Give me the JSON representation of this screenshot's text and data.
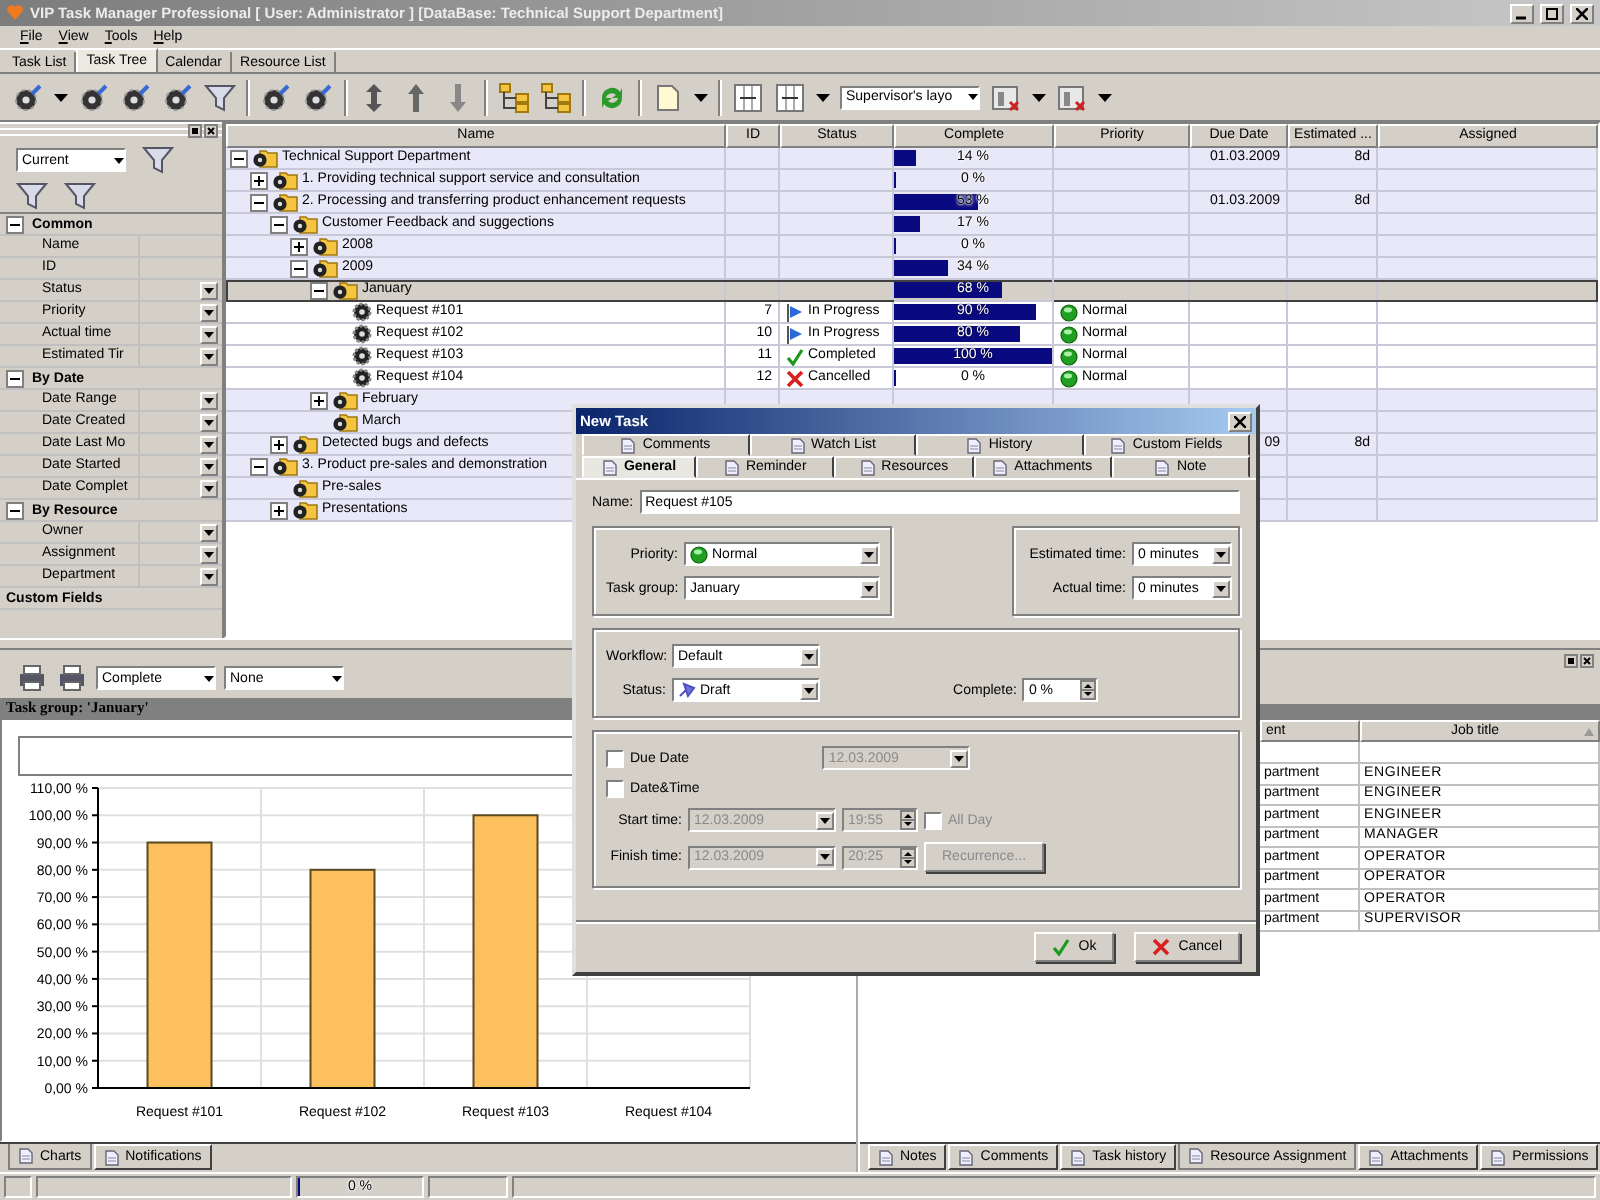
{
  "window": {
    "title": "VIP Task Manager Professional [ User: Administrator ] [DataBase: Technical Support Department]"
  },
  "menu": [
    "File",
    "View",
    "Tools",
    "Help"
  ],
  "view_tabs": [
    {
      "label": "Task List",
      "selected": false
    },
    {
      "label": "Task Tree",
      "selected": true
    },
    {
      "label": "Calendar",
      "selected": false
    },
    {
      "label": "Resource List",
      "selected": false
    }
  ],
  "toolbar": {
    "layout_select": "Supervisor's layo"
  },
  "filter_panel": {
    "preset": "Current",
    "sections": [
      {
        "kind": "section",
        "title": "Common",
        "expanded": true,
        "items": [
          {
            "label": "Name",
            "dropdown": false
          },
          {
            "label": "ID",
            "dropdown": false
          },
          {
            "label": "Status",
            "dropdown": true
          },
          {
            "label": "Priority",
            "dropdown": true
          },
          {
            "label": "Actual time",
            "dropdown": true
          },
          {
            "label": "Estimated Tir",
            "dropdown": true
          }
        ]
      },
      {
        "kind": "section",
        "title": "By Date",
        "expanded": true,
        "items": [
          {
            "label": "Date Range",
            "dropdown": true
          },
          {
            "label": "Date Created",
            "dropdown": true
          },
          {
            "label": "Date Last Mo",
            "dropdown": true
          },
          {
            "label": "Date Started",
            "dropdown": true
          },
          {
            "label": "Date Complet",
            "dropdown": true
          }
        ]
      },
      {
        "kind": "section",
        "title": "By Resource",
        "expanded": true,
        "items": [
          {
            "label": "Owner",
            "dropdown": true
          },
          {
            "label": "Assignment",
            "dropdown": true
          },
          {
            "label": "Department",
            "dropdown": true
          }
        ]
      },
      {
        "kind": "plain",
        "title": "Custom Fields"
      }
    ]
  },
  "tree": {
    "columns": [
      "Name",
      "ID",
      "Status",
      "Complete",
      "Priority",
      "Due Date",
      "Estimated ...",
      "Assigned"
    ],
    "rows": [
      {
        "kind": "group",
        "expanded": true,
        "selected": false,
        "name": "Technical Support Department",
        "complete": "14 %",
        "level": 0.14,
        "due_date": "01.03.2009",
        "estimated": "8d",
        "children": [
          {
            "kind": "group",
            "expanded": false,
            "selected": false,
            "name": "1. Providing technical support service and consultation",
            "complete": "0 %",
            "level": 0
          },
          {
            "kind": "group",
            "expanded": true,
            "selected": false,
            "name": "2. Processing and transferring product enhancement requests",
            "complete": "53 %",
            "level": 0.53,
            "due_date": "01.03.2009",
            "estimated": "8d",
            "children": [
              {
                "kind": "group",
                "expanded": true,
                "selected": false,
                "name": "Customer Feedback and suggections",
                "complete": "17 %",
                "level": 0.17,
                "children": [
                  {
                    "kind": "group",
                    "expanded": false,
                    "selected": false,
                    "name": "2008",
                    "complete": "0 %",
                    "level": 0
                  },
                  {
                    "kind": "group",
                    "expanded": true,
                    "selected": false,
                    "name": "2009",
                    "complete": "34 %",
                    "level": 0.34,
                    "children": [
                      {
                        "kind": "group",
                        "expanded": true,
                        "selected": true,
                        "name": "January",
                        "complete": "68 %",
                        "level": 0.68,
                        "children": [
                          {
                            "kind": "flagged",
                            "selected": false,
                            "name": "Request #101",
                            "id": "7",
                            "status": "In Progress",
                            "complete": "90 %",
                            "level": 0.9,
                            "priority": "Normal"
                          },
                          {
                            "kind": "flagged",
                            "selected": false,
                            "name": "Request #102",
                            "id": "10",
                            "status": "In Progress",
                            "complete": "80 %",
                            "level": 0.8,
                            "priority": "Normal"
                          },
                          {
                            "kind": "completed",
                            "selected": false,
                            "name": "Request #103",
                            "id": "11",
                            "status": "Completed",
                            "complete": "100 %",
                            "level": 1,
                            "priority": "Normal"
                          },
                          {
                            "kind": "cancelled",
                            "selected": false,
                            "name": "Request #104",
                            "id": "12",
                            "status": "Cancelled",
                            "complete": "0 %",
                            "level": 0,
                            "priority": "Normal"
                          }
                        ]
                      },
                      {
                        "kind": "group",
                        "expanded": false,
                        "selected": false,
                        "name": "February"
                      },
                      {
                        "kind": "empty_group",
                        "selected": false,
                        "name": "March"
                      }
                    ]
                  }
                ]
              },
              {
                "kind": "group",
                "expanded": false,
                "selected": false,
                "name": "Detected bugs and defects",
                "due_date": "09",
                "estimated": "8d"
              }
            ]
          },
          {
            "kind": "group",
            "expanded": true,
            "selected": false,
            "name": "3. Product pre-sales and demonstration",
            "children": [
              {
                "kind": "empty_group",
                "selected": false,
                "name": "Pre-sales"
              },
              {
                "kind": "group",
                "expanded": false,
                "selected": false,
                "name": "Presentations"
              }
            ]
          }
        ]
      }
    ]
  },
  "chart_panel": {
    "metric": "Complete",
    "grouping": "None",
    "header": "Task group: 'January'",
    "chart_data": {
      "type": "bar",
      "categories": [
        "Request #101",
        "Request #102",
        "Request #103",
        "Request #104"
      ],
      "series": [
        {
          "color": "#fcc05e",
          "values": [
            90,
            80,
            100,
            0
          ]
        }
      ],
      "grid": true,
      "ylim": [
        0,
        110
      ],
      "yticks": [
        {
          "value": 0,
          "label": "0,00 %"
        },
        {
          "value": 10,
          "label": "10,00 %"
        },
        {
          "value": 20,
          "label": "20,00 %"
        },
        {
          "value": 30,
          "label": "30,00 %"
        },
        {
          "value": 40,
          "label": "40,00 %"
        },
        {
          "value": 50,
          "label": "50,00 %"
        },
        {
          "value": 60,
          "label": "60,00 %"
        },
        {
          "value": 70,
          "label": "70,00 %"
        },
        {
          "value": 80,
          "label": "80,00 %"
        },
        {
          "value": 90,
          "label": "90,00 %"
        },
        {
          "value": 100,
          "label": "100,00 %"
        },
        {
          "value": 110,
          "label": "110,00 %"
        }
      ]
    },
    "tabs": [
      {
        "label": "Charts",
        "selected": true
      },
      {
        "label": "Notifications",
        "selected": false
      }
    ]
  },
  "resource_panel": {
    "columns": [
      "ent",
      "Job title"
    ],
    "rows": [
      {
        "department": "partment",
        "job_title": "ENGINEER"
      },
      {
        "department": "partment",
        "job_title": "ENGINEER"
      },
      {
        "department": "partment",
        "job_title": "ENGINEER"
      },
      {
        "department": "partment",
        "job_title": "MANAGER"
      },
      {
        "department": "partment",
        "job_title": "OPERATOR"
      },
      {
        "department": "partment",
        "job_title": "OPERATOR"
      },
      {
        "department": "partment",
        "job_title": "OPERATOR"
      },
      {
        "department": "partment",
        "job_title": "SUPERVISOR"
      }
    ],
    "tabs": [
      {
        "label": "Notes",
        "selected": false
      },
      {
        "label": "Comments",
        "selected": false
      },
      {
        "label": "Task history",
        "selected": false
      },
      {
        "label": "Resource Assignment",
        "selected": true
      },
      {
        "label": "Attachments",
        "selected": false
      },
      {
        "label": "Permissions",
        "selected": false
      }
    ]
  },
  "status_bar": {
    "progress": "0 %",
    "level": 0
  },
  "dialog": {
    "title": "New Task",
    "tab_rows": [
      [
        {
          "label": "Comments",
          "selected": false
        },
        {
          "label": "Watch List",
          "selected": false
        },
        {
          "label": "History",
          "selected": false
        },
        {
          "label": "Custom Fields",
          "selected": false
        }
      ],
      [
        {
          "label": "General",
          "selected": true
        },
        {
          "label": "Reminder",
          "selected": false
        },
        {
          "label": "Resources",
          "selected": false
        },
        {
          "label": "Attachments",
          "selected": false
        },
        {
          "label": "Note",
          "selected": false
        }
      ]
    ],
    "name_label": "Name:",
    "name": "Request #105",
    "priority_label": "Priority:",
    "priority": "Normal",
    "task_group_label": "Task group:",
    "task_group": "January",
    "estimated_label": "Estimated time:",
    "estimated": "0 minutes",
    "actual_label": "Actual time:",
    "actual": "0 minutes",
    "workflow_label": "Workflow:",
    "workflow": "Default",
    "status_label": "Status:",
    "status": "Draft",
    "complete_label": "Complete:",
    "complete": "0 %",
    "due_date": {
      "label": "Due Date",
      "checked": false,
      "value": "12.03.2009"
    },
    "date_time": {
      "label": "Date&Time",
      "checked": false
    },
    "start": {
      "label": "Start time:",
      "date": "12.03.2009",
      "time": "19:55"
    },
    "all_day": {
      "label": "All Day",
      "checked": false
    },
    "finish": {
      "label": "Finish time:",
      "date": "12.03.2009",
      "time": "20:25"
    },
    "recurrence": "Recurrence...",
    "buttons": [
      {
        "kind": "ok",
        "label": "Ok"
      },
      {
        "kind": "cancel",
        "label": "Cancel"
      }
    ]
  }
}
